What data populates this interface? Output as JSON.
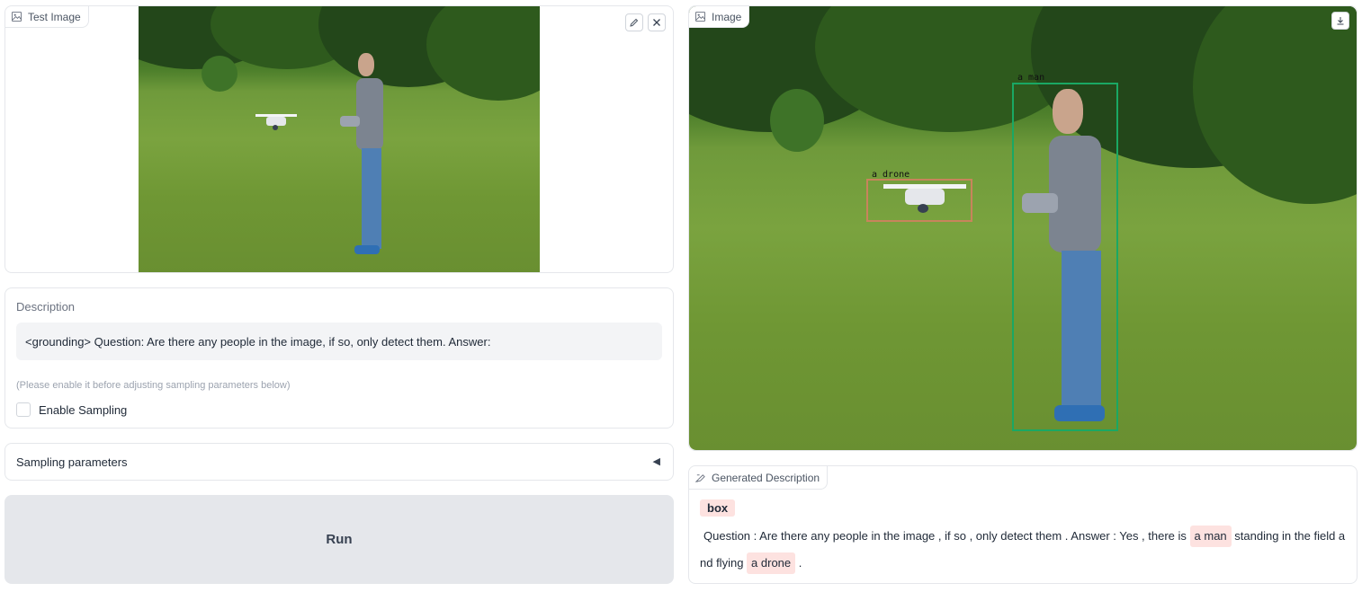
{
  "input_panel": {
    "tag_label": "Test Image",
    "edit_icon": "pencil-icon",
    "clear_icon": "close-icon"
  },
  "description": {
    "label": "Description",
    "value": "<grounding> Question: Are there any people in the image, if so, only detect them. Answer:",
    "hint": "(Please enable it before adjusting sampling parameters below)",
    "checkbox_label": "Enable Sampling",
    "checkbox_checked": false
  },
  "sampling": {
    "label": "Sampling parameters",
    "toggle_glyph": "◀"
  },
  "run_button": {
    "label": "Run"
  },
  "output_image": {
    "tag_label": "Image",
    "download_icon": "download-icon",
    "boxes": [
      {
        "label": "a drone",
        "color": "#c8845c"
      },
      {
        "label": "a man",
        "color": "#1aa864"
      }
    ]
  },
  "generated": {
    "tag_label": "Generated Description",
    "legend_label": "box",
    "text_1": "Question : Are there any people in the image , if so , only detect them . Answer : Yes , there is ",
    "entity_1": "a man",
    "text_2": " standing in the field a",
    "text_3": "nd flying ",
    "entity_2": "a drone",
    "text_4": " ."
  }
}
